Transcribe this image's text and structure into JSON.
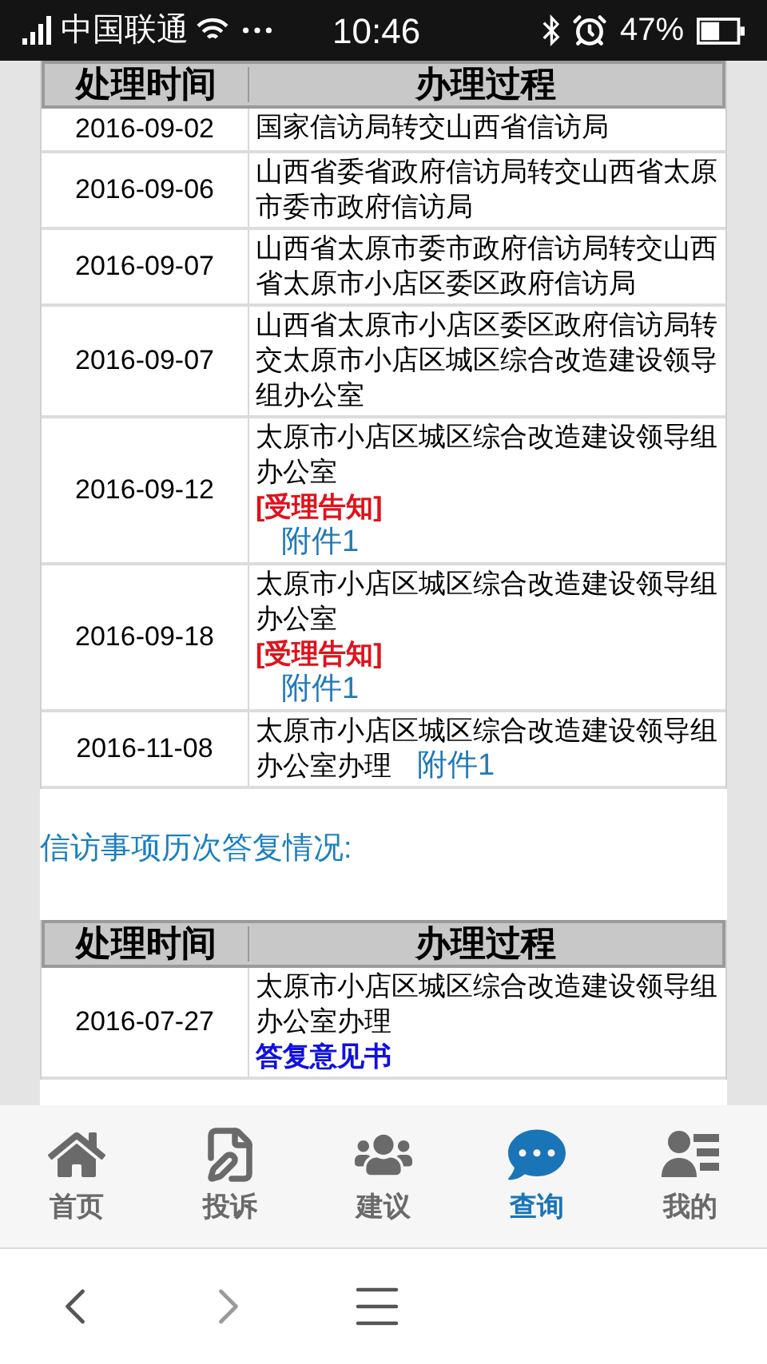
{
  "status_bar": {
    "carrier": "中国联通",
    "time": "10:46",
    "battery": "47%"
  },
  "process_table": {
    "columns": [
      "处理时间",
      "办理过程"
    ],
    "rows": [
      {
        "date": "2016-09-02",
        "process": [
          {
            "kind": "text",
            "text": "国家信访局转交山西省信访局"
          }
        ]
      },
      {
        "date": "2016-09-06",
        "process": [
          {
            "kind": "text",
            "text": "山西省委省政府信访局转交山西省太原市委市政府信访局"
          }
        ]
      },
      {
        "date": "2016-09-07",
        "process": [
          {
            "kind": "text",
            "text": "山西省太原市委市政府信访局转交山西省太原市小店区委区政府信访局"
          }
        ]
      },
      {
        "date": "2016-09-07",
        "process": [
          {
            "kind": "text",
            "text": "山西省太原市小店区委区政府信访局转交太原市小店区城区综合改造建设领导组办公室"
          }
        ]
      },
      {
        "date": "2016-09-12",
        "process": [
          {
            "kind": "text",
            "text": "太原市小店区城区综合改造建设领导组办公室"
          },
          {
            "kind": "notice",
            "text": "[受理告知]"
          },
          {
            "kind": "attachment",
            "text": "附件1"
          }
        ]
      },
      {
        "date": "2016-09-18",
        "process": [
          {
            "kind": "text",
            "text": "太原市小店区城区综合改造建设领导组办公室"
          },
          {
            "kind": "notice",
            "text": "[受理告知]"
          },
          {
            "kind": "attachment",
            "text": "附件1"
          }
        ]
      },
      {
        "date": "2016-11-08",
        "process": [
          {
            "kind": "text_with_attachment",
            "text": "太原市小店区城区综合改造建设领导组办公室办理",
            "attachment": "附件1"
          }
        ]
      }
    ]
  },
  "reply_heading": "信访事项历次答复情况:",
  "reply_table": {
    "columns": [
      "处理时间",
      "办理过程"
    ],
    "rows": [
      {
        "date": "2016-07-27",
        "process": [
          {
            "kind": "text",
            "text": "太原市小店区城区综合改造建设领导组办公室办理"
          },
          {
            "kind": "reply",
            "text": "答复意见书"
          }
        ]
      }
    ]
  },
  "tab_bar": [
    {
      "label": "首页",
      "selected": false
    },
    {
      "label": "投诉",
      "selected": false
    },
    {
      "label": "建议",
      "selected": false
    },
    {
      "label": "查询",
      "selected": true
    },
    {
      "label": "我的",
      "selected": false
    }
  ]
}
